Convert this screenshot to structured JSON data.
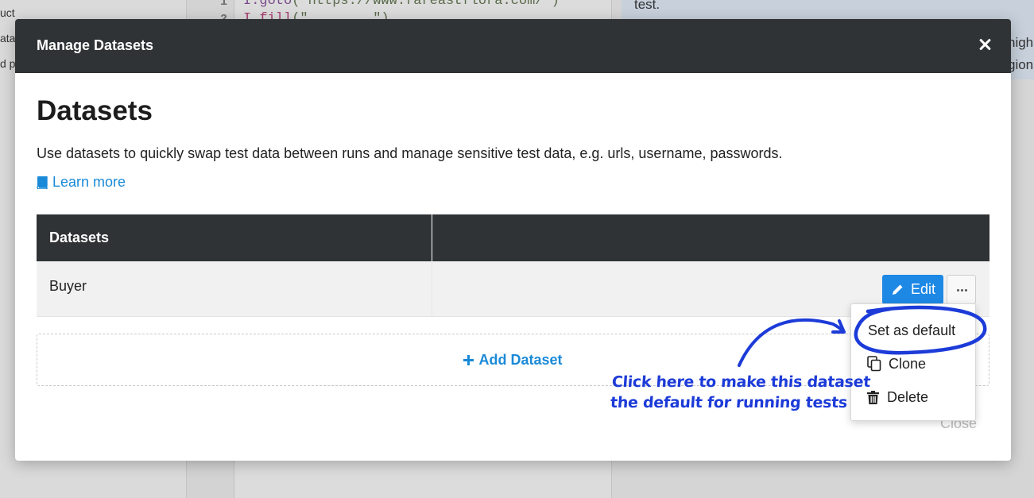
{
  "background": {
    "left_fragments": [
      "uct",
      "ata",
      "d p"
    ],
    "gutter_numbers": [
      "1",
      "2"
    ],
    "code_lines": [
      {
        "prefix": "I.",
        "fn": "goto",
        "rest": "(\"https://www.fareastflora.com/\")"
      },
      {
        "prefix": "I.",
        "fn": "fill",
        "rest": "(\"........\")"
      }
    ],
    "right_fragments": [
      "test.",
      "nigh",
      "gion"
    ]
  },
  "modal": {
    "title": "Manage Datasets",
    "heading": "Datasets",
    "description": "Use datasets to quickly swap test data between runs and manage sensitive test data, e.g. urls, username, passwords.",
    "learn_more": "Learn more",
    "table": {
      "headers": [
        "Datasets",
        ""
      ],
      "rows": [
        {
          "name": "Buyer",
          "edit_label": "Edit"
        }
      ]
    },
    "add_dataset": "Add Dataset",
    "close": "Close"
  },
  "menu": {
    "items": [
      "Set as default",
      "Clone",
      "Delete"
    ]
  },
  "annotation": {
    "line1": "Click here to make this dataset",
    "line2": "the default for running tests"
  },
  "colors": {
    "header_bg": "#2f3335",
    "accent": "#1e88e5",
    "link": "#1a8ad8",
    "annotation": "#1c3bd8"
  }
}
